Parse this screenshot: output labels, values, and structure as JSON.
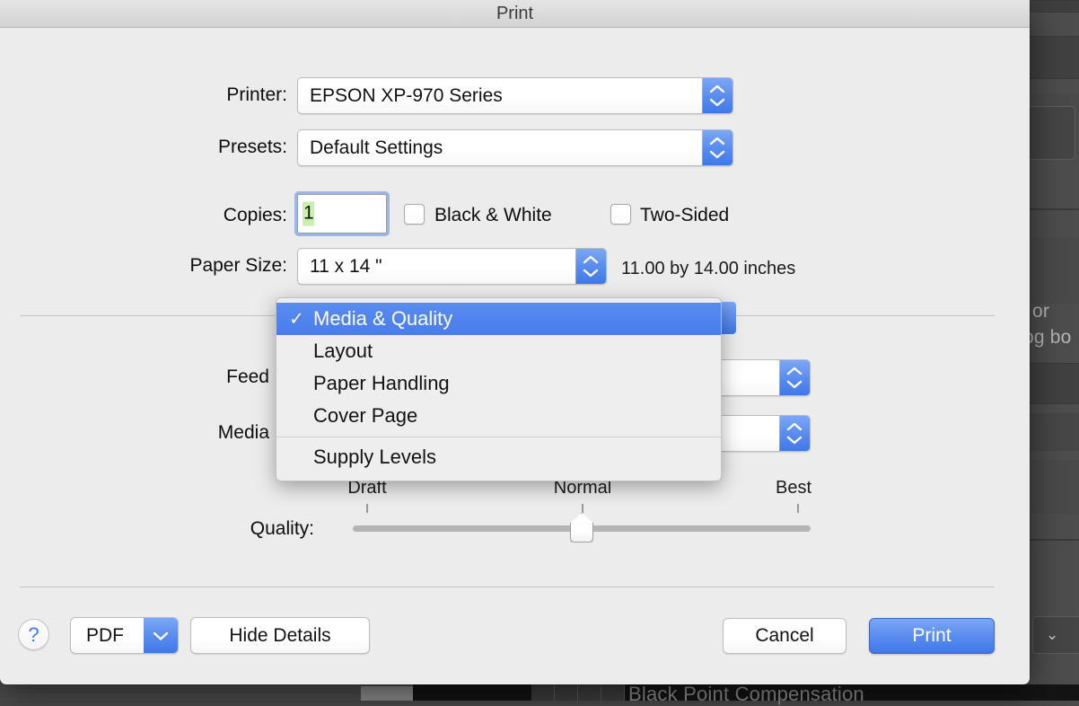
{
  "window": {
    "title": "Print"
  },
  "fields": {
    "printer": {
      "label": "Printer:",
      "value": "EPSON XP-970 Series"
    },
    "presets": {
      "label": "Presets:",
      "value": "Default Settings"
    },
    "copies": {
      "label": "Copies:",
      "value": "1"
    },
    "paper_size": {
      "label": "Paper Size:",
      "value": "11 x 14 \"",
      "dimensions_note": "11.00 by 14.00 inches"
    },
    "feed": {
      "label": "Feed"
    },
    "media": {
      "label": "Media"
    },
    "quality": {
      "label": "Quality:"
    }
  },
  "checkboxes": [
    {
      "label": "Black & White",
      "checked": false
    },
    {
      "label": "Two-Sided",
      "checked": false
    }
  ],
  "quality_slider": {
    "ticks": [
      "Draft",
      "Normal",
      "Best"
    ],
    "value": "Normal"
  },
  "menu": {
    "items": [
      {
        "label": "Media & Quality",
        "selected": true,
        "check": "✓"
      },
      {
        "label": "Layout",
        "selected": false,
        "check": ""
      },
      {
        "label": "Paper Handling",
        "selected": false,
        "check": ""
      },
      {
        "label": "Cover Page",
        "selected": false,
        "check": ""
      }
    ],
    "footer_items": [
      {
        "label": "Supply Levels"
      }
    ]
  },
  "buttons": {
    "help": "?",
    "pdf": "PDF",
    "hide_details": "Hide Details",
    "cancel": "Cancel",
    "print": "Print"
  },
  "background": {
    "fragment_1": "or",
    "fragment_2": "og bo",
    "fragment_3": "Black Point Compensation"
  },
  "colors": {
    "accent_blue": "#4a7dec",
    "dialog_bg": "#ececec",
    "menu_highlight": "#4a7dec",
    "copies_selection_green": "#c9f0ac",
    "backdrop_dark": "#4d4d4d"
  }
}
